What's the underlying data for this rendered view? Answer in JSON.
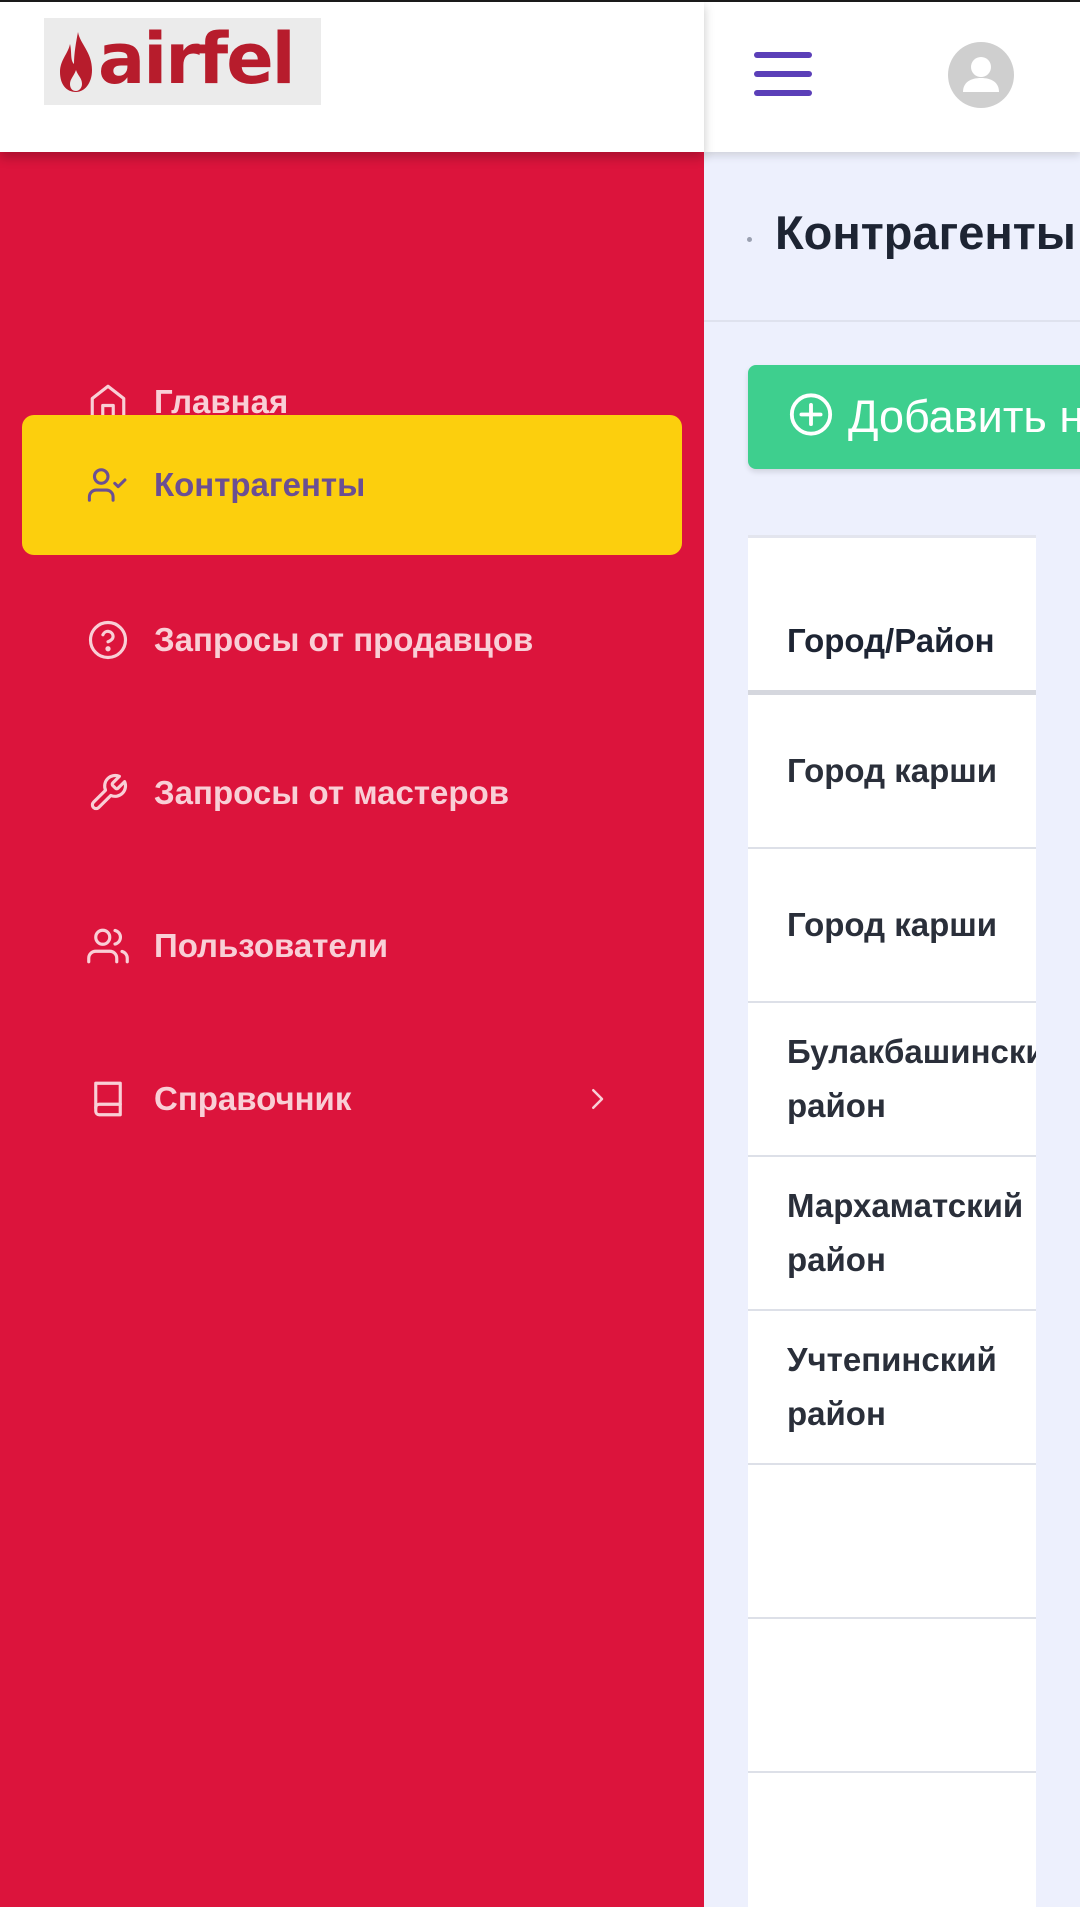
{
  "brand": {
    "logo_text": "airfel",
    "brand_color": "#b71c2c"
  },
  "theme": {
    "sidebar_bg": "#dc143c",
    "active_bg": "#fccf0d",
    "accent": "#5b3fb8",
    "button_green": "#3ecf8e"
  },
  "sidebar": {
    "items": [
      {
        "label": "Главная",
        "icon": "home-icon",
        "active": false
      },
      {
        "label": "Контрагенты",
        "icon": "user-check-icon",
        "active": true
      },
      {
        "label": "Запросы от продавцов",
        "icon": "question-circle-icon",
        "active": false
      },
      {
        "label": "Запросы от мастеров",
        "icon": "wrench-icon",
        "active": false
      },
      {
        "label": "Пользователи",
        "icon": "users-icon",
        "active": false
      },
      {
        "label": "Справочник",
        "icon": "book-icon",
        "active": false,
        "has_submenu": true
      }
    ]
  },
  "header": {
    "menu_icon": "hamburger-menu-icon",
    "avatar_icon": "user-avatar-icon"
  },
  "main": {
    "page_title": "Контрагенты",
    "add_button_label": "Добавить н",
    "table": {
      "header": "Город/Район",
      "rows": [
        "Город карши",
        "Город карши",
        "Булакбашинский район",
        "Мархаматский район",
        "Учтепинский район",
        "",
        "",
        ""
      ]
    }
  }
}
